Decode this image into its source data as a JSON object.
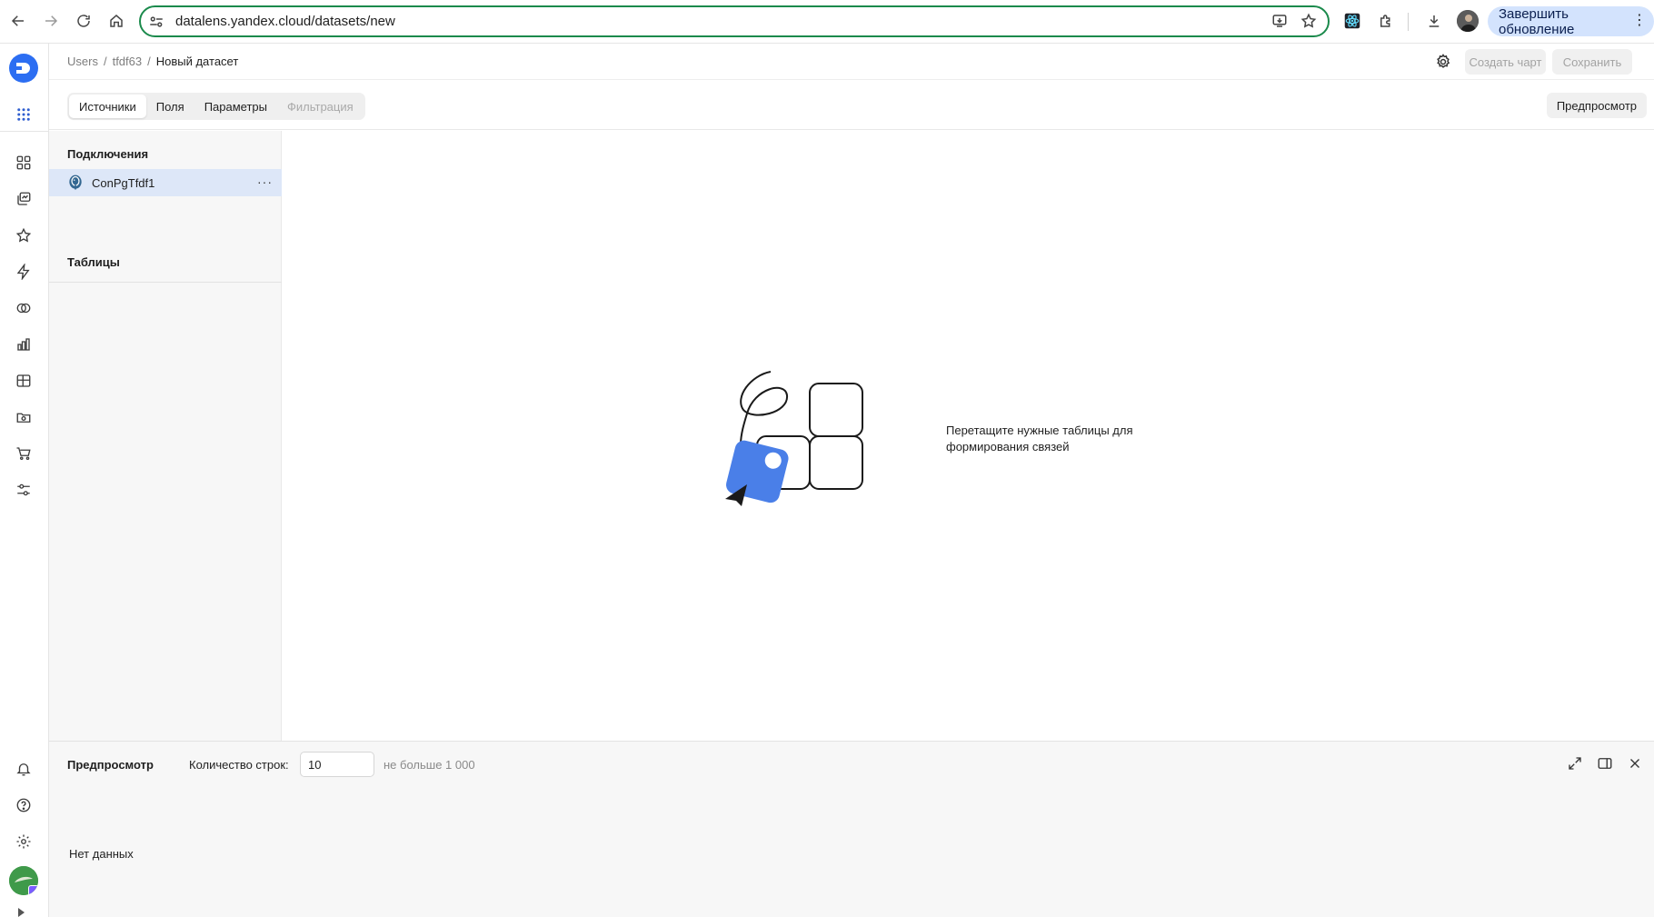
{
  "browser": {
    "url": "datalens.yandex.cloud/datasets/new",
    "update_button": "Завершить обновление"
  },
  "header": {
    "breadcrumb": [
      "Users",
      "tfdf63",
      "Новый датасет"
    ],
    "separator": "/",
    "create_chart": "Создать чарт",
    "save": "Сохранить"
  },
  "tabs": {
    "items": [
      {
        "label": "Источники",
        "state": "active"
      },
      {
        "label": "Поля",
        "state": "normal"
      },
      {
        "label": "Параметры",
        "state": "normal"
      },
      {
        "label": "Фильтрация",
        "state": "disabled"
      }
    ],
    "preview_button": "Предпросмотр"
  },
  "sources": {
    "connections_title": "Подключения",
    "connection_name": "ConPgTfdf1",
    "more": "···",
    "tables_title": "Таблицы"
  },
  "canvas": {
    "hint": "Перетащите нужные таблицы для формирования связей"
  },
  "preview": {
    "title": "Предпросмотр",
    "rows_label": "Количество строк:",
    "rows_value": "10",
    "limit": "не больше 1 000",
    "empty": "Нет данных"
  },
  "colors": {
    "accent": "#4a7fe8",
    "selected_row": "#dde7f8",
    "omnibox_border": "#1b8a4c",
    "update_button_bg": "#d3e3fd"
  }
}
